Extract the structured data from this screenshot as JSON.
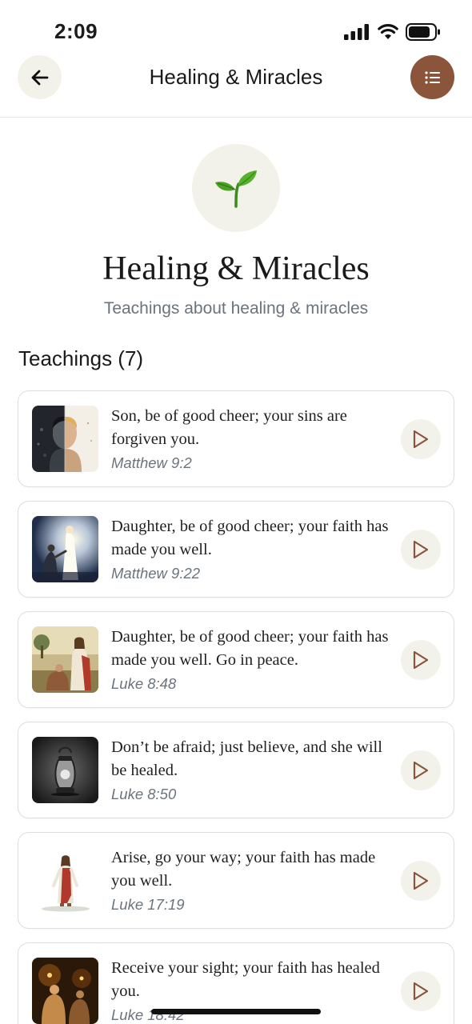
{
  "status_bar": {
    "time": "2:09"
  },
  "nav": {
    "title": "Healing & Miracles"
  },
  "header": {
    "icon": "seedling-icon",
    "title": "Healing & Miracles",
    "subtitle": "Teachings about healing & miracles"
  },
  "section": {
    "label": "Teachings (7)"
  },
  "teachings": [
    {
      "quote": "Son, be of good cheer; your sins are forgiven you.",
      "reference": "Matthew 9:2",
      "thumbnail": "split-face-image"
    },
    {
      "quote": "Daughter, be of good cheer; your faith has made you well.",
      "reference": "Matthew 9:22",
      "thumbnail": "radiant-figure-image"
    },
    {
      "quote": "Daughter, be of good cheer; your faith has made you well. Go in peace.",
      "reference": "Luke 8:48",
      "thumbnail": "kneeling-woman-image"
    },
    {
      "quote": "Don’t be afraid; just believe, and she will be healed.",
      "reference": "Luke 8:50",
      "thumbnail": "lantern-image"
    },
    {
      "quote": "Arise, go your way; your faith has made you well.",
      "reference": "Luke 17:19",
      "thumbnail": "walking-figure-image"
    },
    {
      "quote": "Receive your sight; your faith has healed you.",
      "reference": "Luke 18:42",
      "thumbnail": "candlelit-figures-image"
    }
  ],
  "colors": {
    "accent": "#8a553a",
    "chip_bg": "#f3f2ea",
    "muted_text": "#6b737d"
  }
}
